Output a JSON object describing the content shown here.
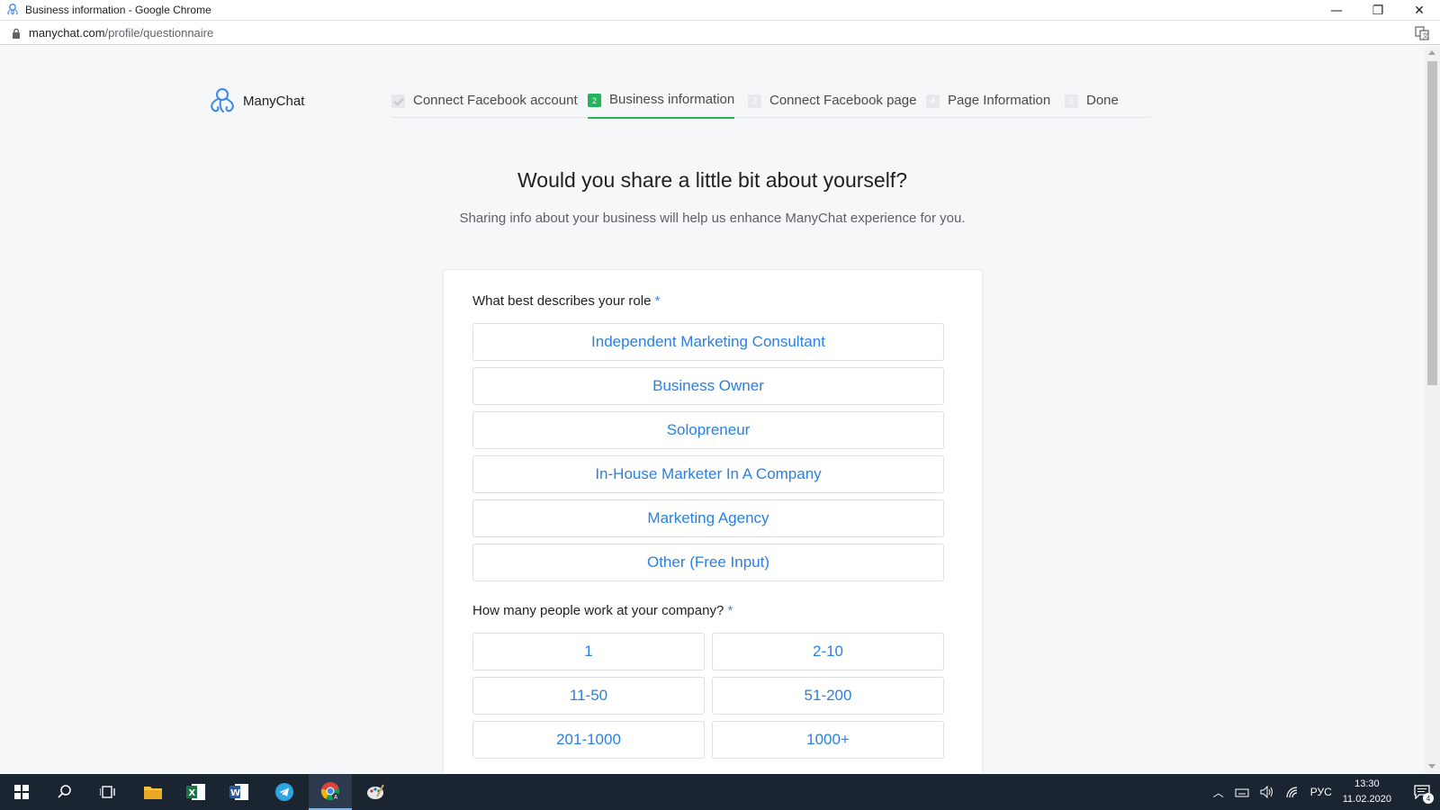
{
  "window": {
    "title": "Business information - Google Chrome",
    "minimize_glyph": "—",
    "restore_glyph": "❐",
    "close_glyph": "✕"
  },
  "address": {
    "domain": "manychat.com",
    "path": "/profile/questionnaire"
  },
  "brand": {
    "name": "ManyChat",
    "accent": "#22b35b",
    "link_color": "#2a80e2"
  },
  "steps": [
    {
      "label": "Connect Facebook account",
      "num": "",
      "state": "done"
    },
    {
      "label": "Business information",
      "num": "2",
      "state": "active"
    },
    {
      "label": "Connect Facebook page",
      "num": "3",
      "state": "pending"
    },
    {
      "label": "Page Information",
      "num": "4",
      "state": "pending"
    },
    {
      "label": "Done",
      "num": "5",
      "state": "pending"
    }
  ],
  "main": {
    "heading": "Would you share a little bit about yourself?",
    "subheading": "Sharing info about your business will help us enhance ManyChat experience for you."
  },
  "role_question": {
    "label": "What best describes your role",
    "required_mark": "*",
    "options": [
      "Independent Marketing Consultant",
      "Business Owner",
      "Solopreneur",
      "In-House Marketer In A Company",
      "Marketing Agency",
      "Other (Free Input)"
    ]
  },
  "size_question": {
    "label": "How many people work at your company?",
    "required_mark": "*",
    "options": [
      "1",
      "2-10",
      "11-50",
      "51-200",
      "201-1000",
      "1000+"
    ]
  },
  "taskbar": {
    "language": "РУС",
    "time": "13:30",
    "date": "11.02.2020",
    "notifications": "4"
  }
}
